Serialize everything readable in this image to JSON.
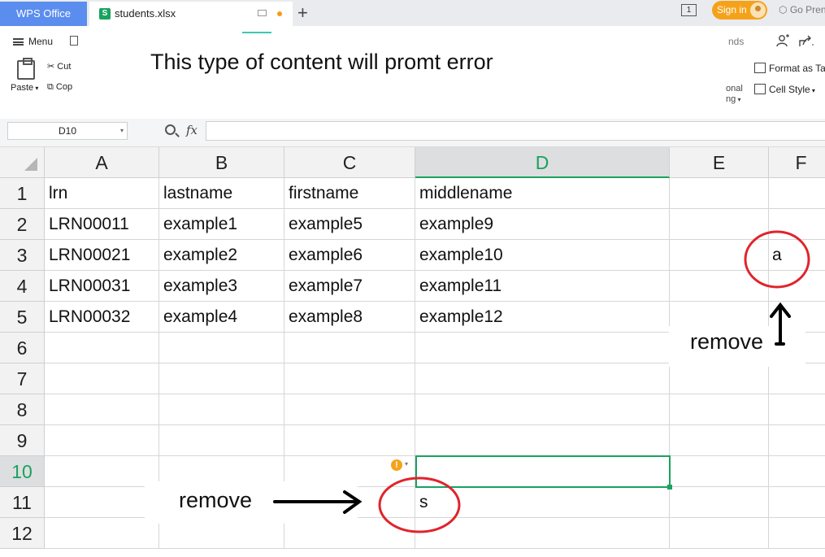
{
  "tabs": {
    "app_tab": "WPS Office",
    "file_tab": "students.xlsx",
    "file_icon_letter": "S",
    "new_tab": "+",
    "window_icon_text": "1"
  },
  "header": {
    "signin": "Sign in",
    "go_premium": "Go Pren"
  },
  "ribbon": {
    "menu": "Menu",
    "paste": "Paste",
    "cut": "Cut",
    "copy": "Cop",
    "nds": "nds",
    "format_as_table": "Format as Tal",
    "cell_style": "Cell Style",
    "cond_line1": "onal",
    "cond_line2": "ng"
  },
  "annotation_title": "This type of content will promt error",
  "formula_bar": {
    "name_box": "D10",
    "fx": "fx",
    "formula": ""
  },
  "sheet": {
    "columns": [
      "A",
      "B",
      "C",
      "D",
      "E",
      "F"
    ],
    "active_column": "D",
    "rows": [
      "1",
      "2",
      "3",
      "4",
      "5",
      "6",
      "7",
      "8",
      "9",
      "10",
      "11",
      "12"
    ],
    "active_row": "10",
    "cells": {
      "A1": "lrn",
      "B1": "lastname",
      "C1": "firstname",
      "D1": "middlename",
      "A2": "LRN00011",
      "B2": "example1",
      "C2": "example5",
      "D2": "example9",
      "A3": "LRN00021",
      "B3": "example2",
      "C3": "example6",
      "D3": "example10",
      "A4": "LRN00031",
      "B4": "example3",
      "C4": "example7",
      "D4": "example11",
      "A5": "LRN00032",
      "B5": "example4",
      "C5": "example8",
      "D5": "example12",
      "F3": "a",
      "D11": "s"
    },
    "warning_icon": "!"
  },
  "annotations": {
    "remove_right": "remove",
    "remove_left": "remove",
    "circle_color": "#e0242b",
    "arrow_color": "#000000"
  }
}
